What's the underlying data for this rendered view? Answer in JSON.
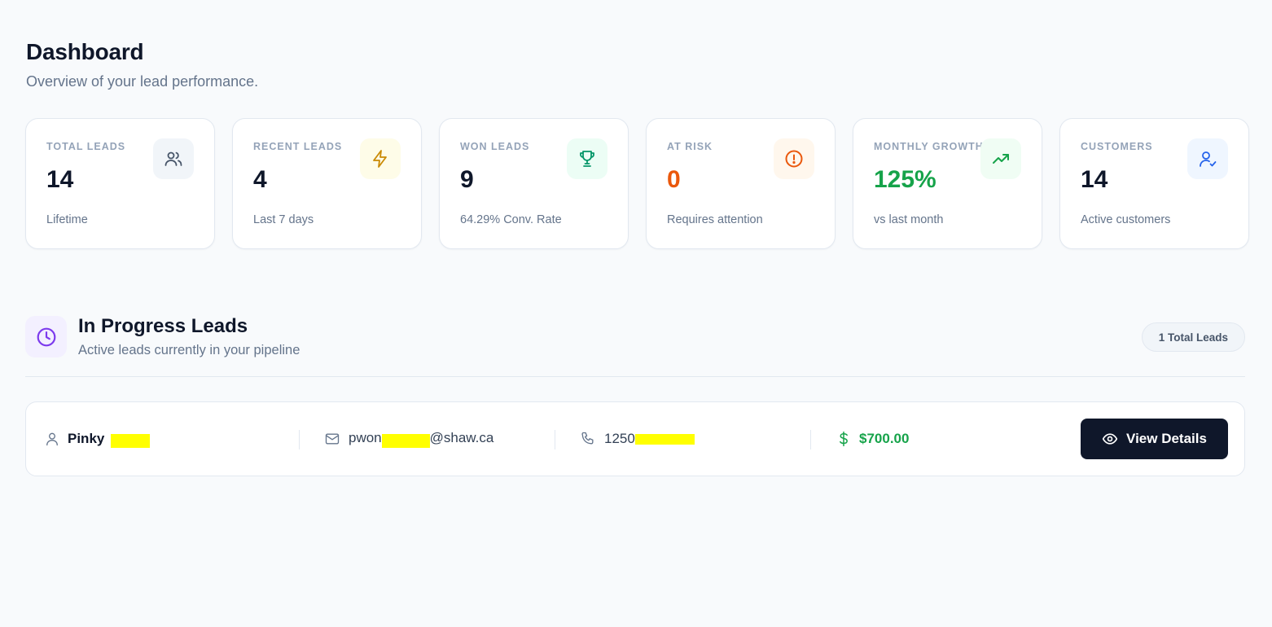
{
  "header": {
    "title": "Dashboard",
    "subtitle": "Overview of your lead performance."
  },
  "stats": [
    {
      "label": "TOTAL LEADS",
      "value": "14",
      "sub": "Lifetime",
      "icon": "users-icon",
      "value_color": "#0f172a",
      "icon_color": "#475569",
      "icon_bg": "#f1f5f9"
    },
    {
      "label": "RECENT LEADS",
      "value": "4",
      "sub": "Last 7 days",
      "icon": "lightning-icon",
      "value_color": "#0f172a",
      "icon_color": "#ca8a04",
      "icon_bg": "#fefce8"
    },
    {
      "label": "WON LEADS",
      "value": "9",
      "sub": "64.29% Conv. Rate",
      "icon": "trophy-icon",
      "value_color": "#0f172a",
      "icon_color": "#059669",
      "icon_bg": "#ecfdf5"
    },
    {
      "label": "AT RISK",
      "value": "0",
      "sub": "Requires attention",
      "icon": "alert-circle-icon",
      "value_color": "#ea580c",
      "icon_color": "#ea580c",
      "icon_bg": "#fff7ed"
    },
    {
      "label": "MONTHLY GROWTH",
      "value": "125%",
      "sub": "vs last month",
      "icon": "trending-up-icon",
      "value_color": "#16a34a",
      "icon_color": "#16a34a",
      "icon_bg": "#f0fdf4"
    },
    {
      "label": "CUSTOMERS",
      "value": "14",
      "sub": "Active customers",
      "icon": "user-check-icon",
      "value_color": "#0f172a",
      "icon_color": "#2563eb",
      "icon_bg": "#eff6ff"
    }
  ],
  "in_progress": {
    "title": "In Progress Leads",
    "subtitle": "Active leads currently in your pipeline",
    "badge": "1 Total Leads",
    "leads": [
      {
        "name": "Pinky",
        "email_prefix": "pwon",
        "email_suffix": "@shaw.ca",
        "phone_prefix": "1250",
        "value": "$700.00",
        "action_label": "View Details"
      }
    ]
  },
  "colors": {
    "accent_dark": "#0f172a",
    "money_green": "#16a34a",
    "section_icon": "#7c3aed",
    "redaction": "#ffff00"
  }
}
